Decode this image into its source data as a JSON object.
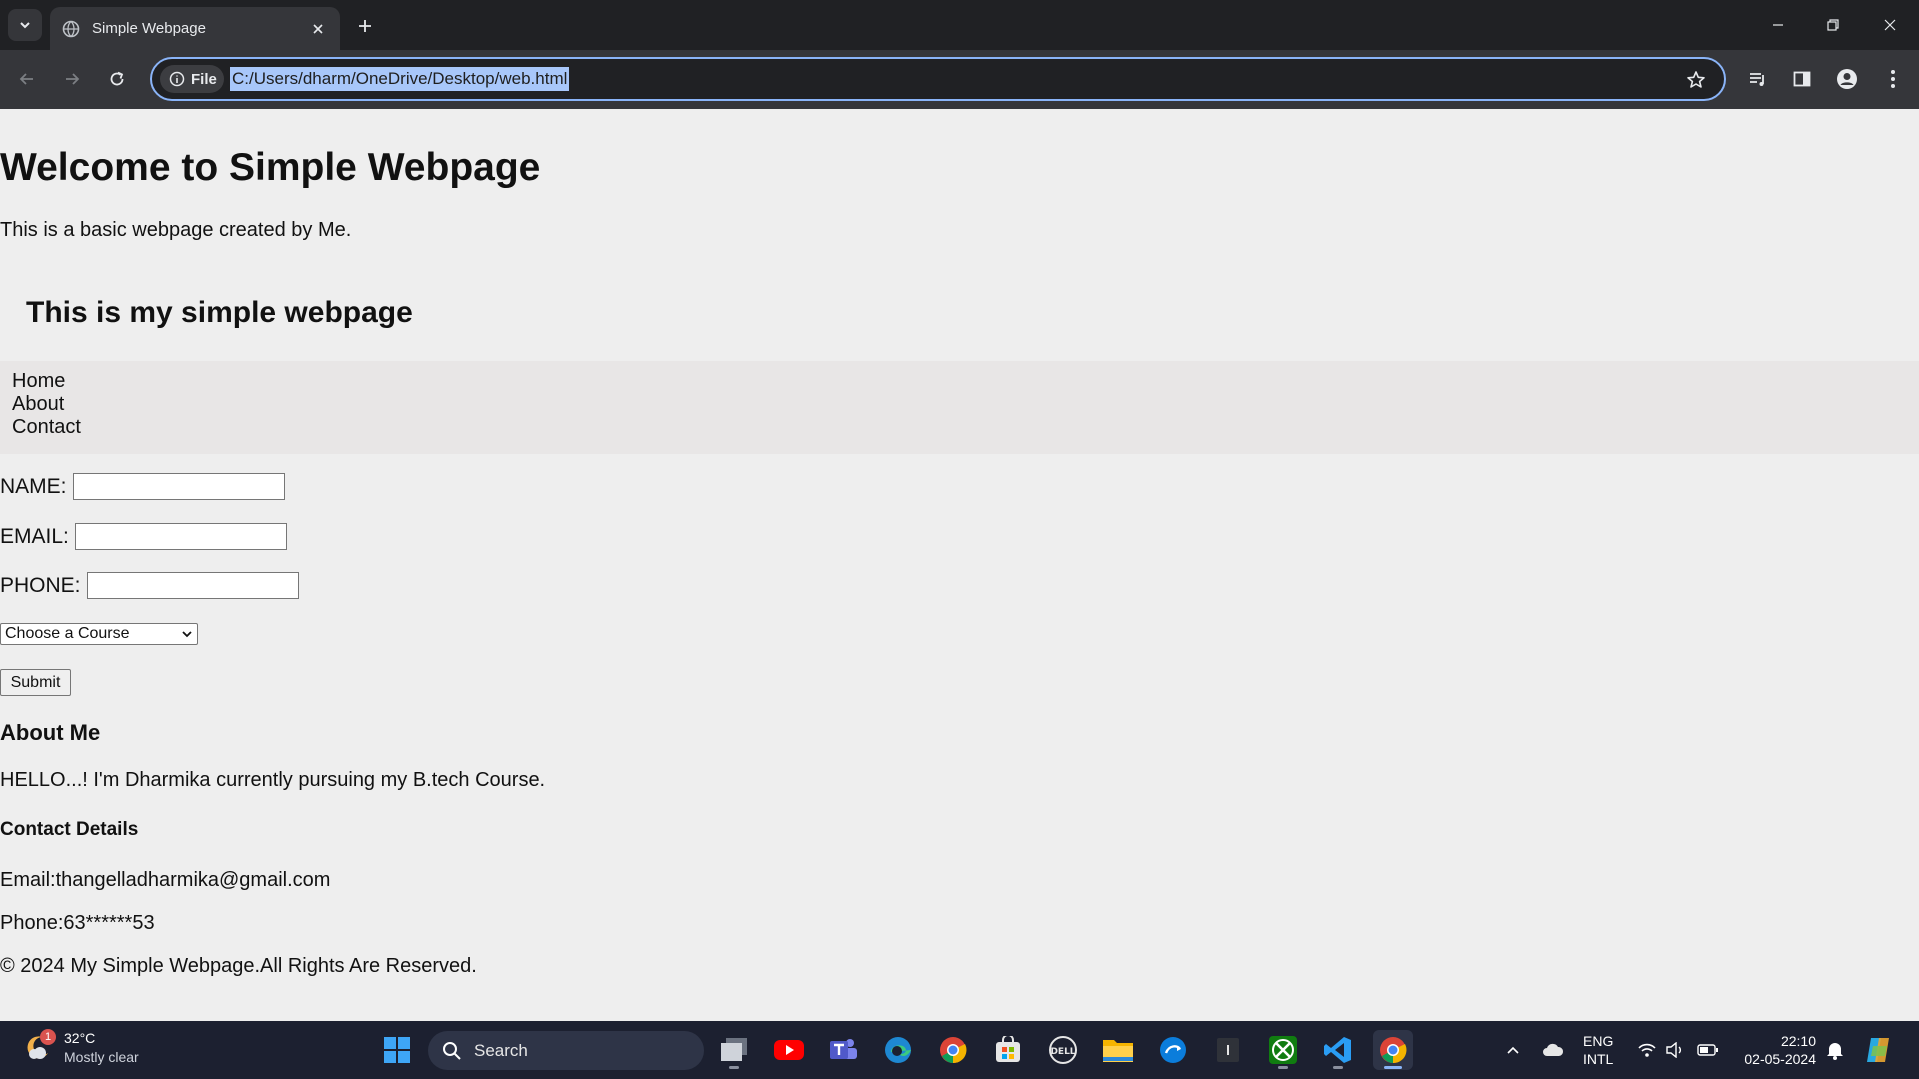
{
  "browser": {
    "tab_title": "Simple Webpage",
    "site_chip_label": "File",
    "url": "C:/Users/dharm/OneDrive/Desktop/web.html"
  },
  "page": {
    "heading": "Welcome to Simple Webpage",
    "intro": "This is a basic webpage created by Me.",
    "subheading": "This is my simple webpage",
    "nav": [
      "Home",
      "About",
      "Contact"
    ],
    "form": {
      "name_label": "NAME:",
      "email_label": "EMAIL:",
      "phone_label": "PHONE:",
      "name_value": "",
      "email_value": "",
      "phone_value": "",
      "course_selected": "Choose a Course",
      "submit_label": "Submit"
    },
    "about_heading": "About Me",
    "about_text": "HELLO...! I'm Dharmika currently pursuing my B.tech Course.",
    "contact_heading": "Contact Details",
    "contact_email": "Email:thangelladharmika@gmail.com",
    "contact_phone": "Phone:63******53",
    "footer": "© 2024 My Simple Webpage.All Rights Are Reserved."
  },
  "taskbar": {
    "weather_temp": "32°C",
    "weather_desc": "Mostly clear",
    "weather_badge": "1",
    "search_label": "Search",
    "lang_line1": "ENG",
    "lang_line2": "INTL",
    "time": "22:10",
    "date": "02-05-2024",
    "apps": [
      "start-icon",
      "task-view-icon",
      "youtube-icon",
      "teams-icon",
      "edge-icon",
      "chrome-icon",
      "microsoft-store-icon",
      "dell-icon",
      "file-explorer-icon",
      "dell-support-icon",
      "notepad-icon",
      "xbox-icon",
      "vscode-icon",
      "chrome-active-icon"
    ]
  },
  "colors": {
    "chrome_dark": "#202124",
    "chrome_toolbar": "#35363a",
    "url_highlight": "#a8c7fa",
    "focus_ring": "#8ab4f8",
    "page_bg": "#eeeeee",
    "nav_bg": "#e8e6e6",
    "taskbar_bg": "#1c2030"
  }
}
